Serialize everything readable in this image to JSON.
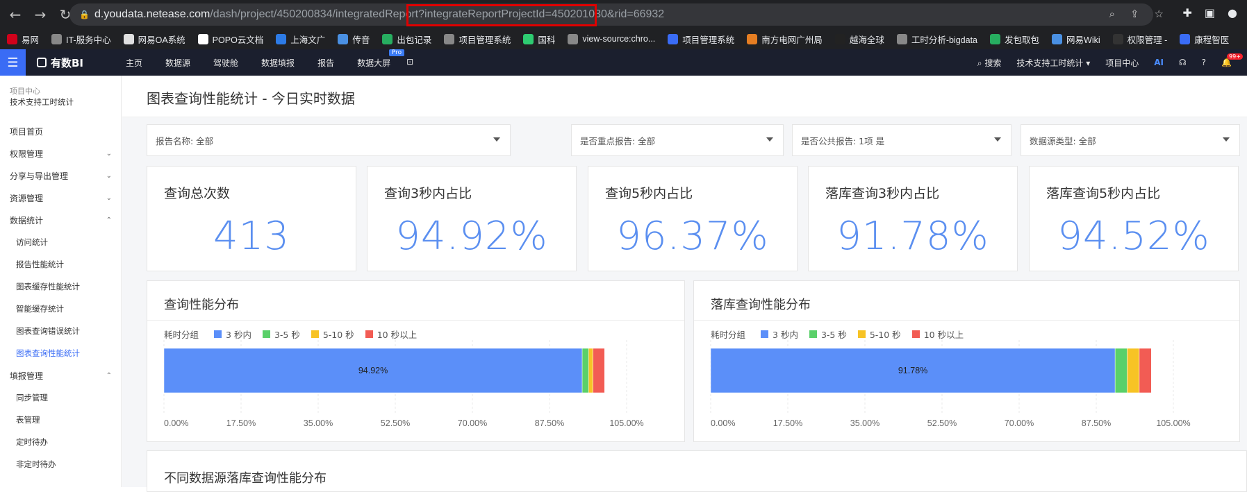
{
  "browser": {
    "url_host": "d.youdata.netease.com",
    "url_path": "/dash/project/450200834/integratedReport",
    "url_query_highlighted": "?integrateReportProjectId=450201030",
    "url_query_rest": "&rid=66932"
  },
  "bookmarks": [
    {
      "label": "易网",
      "color": "#d0021b"
    },
    {
      "label": "IT-服务中心",
      "color": "#888888"
    },
    {
      "label": "网易OA系统",
      "color": "#e0e0e0"
    },
    {
      "label": "POPO云文档",
      "color": "#ffffff"
    },
    {
      "label": "上海文广",
      "color": "#2d7be5"
    },
    {
      "label": "传音",
      "color": "#4a90e2"
    },
    {
      "label": "出包记录",
      "color": "#27ae60"
    },
    {
      "label": "项目管理系统",
      "color": "#888888"
    },
    {
      "label": "国科",
      "color": "#2ecc71"
    },
    {
      "label": "view-source:chro...",
      "color": "#888888"
    },
    {
      "label": "项目管理系统",
      "color": "#3a6cf5"
    },
    {
      "label": "南方电网广州局",
      "color": "#e67e22"
    },
    {
      "label": "越海全球",
      "color": "#222222"
    },
    {
      "label": "工时分析-bigdata",
      "color": "#888888"
    },
    {
      "label": "发包取包",
      "color": "#27ae60"
    },
    {
      "label": "网易Wiki",
      "color": "#4a90e2"
    },
    {
      "label": "权限管理 -",
      "color": "#333333"
    },
    {
      "label": "康程智医",
      "color": "#3a6cf5"
    }
  ],
  "appbar": {
    "logo": "有数BI",
    "nav": [
      "主页",
      "数据源",
      "驾驶舱",
      "数据填报",
      "报告",
      "数据大屏"
    ],
    "pro_badge": "Pro",
    "search": "搜索",
    "project_select": "技术支持工时统计",
    "project_center": "项目中心",
    "ai": "AI",
    "notif_badge": "99+"
  },
  "sidebar": {
    "project_label": "项目中心",
    "project_name": "技术支持工时统计",
    "items": [
      {
        "label": "项目首页",
        "sub": false,
        "chev": "",
        "active": false
      },
      {
        "label": "权限管理",
        "sub": false,
        "chev": "⌄",
        "active": false
      },
      {
        "label": "分享与导出管理",
        "sub": false,
        "chev": "⌄",
        "active": false
      },
      {
        "label": "资源管理",
        "sub": false,
        "chev": "⌄",
        "active": false
      },
      {
        "label": "数据统计",
        "sub": false,
        "chev": "⌃",
        "active": false
      },
      {
        "label": "访问统计",
        "sub": true,
        "chev": "",
        "active": false
      },
      {
        "label": "报告性能统计",
        "sub": true,
        "chev": "",
        "active": false
      },
      {
        "label": "图表缓存性能统计",
        "sub": true,
        "chev": "",
        "active": false
      },
      {
        "label": "智能缓存统计",
        "sub": true,
        "chev": "",
        "active": false
      },
      {
        "label": "图表查询错误统计",
        "sub": true,
        "chev": "",
        "active": false
      },
      {
        "label": "图表查询性能统计",
        "sub": true,
        "chev": "",
        "active": true
      },
      {
        "label": "填报管理",
        "sub": false,
        "chev": "⌃",
        "active": false
      },
      {
        "label": "同步管理",
        "sub": true,
        "chev": "",
        "active": false
      },
      {
        "label": "表管理",
        "sub": true,
        "chev": "",
        "active": false
      },
      {
        "label": "定时待办",
        "sub": true,
        "chev": "",
        "active": false
      },
      {
        "label": "非定时待办",
        "sub": true,
        "chev": "",
        "active": false
      }
    ]
  },
  "page": {
    "title": "图表查询性能统计 - 今日实时数据",
    "filters": [
      "报告名称: 全部",
      "是否重点报告: 全部",
      "是否公共报告: 1项 是",
      "数据源类型: 全部"
    ],
    "kpis": [
      {
        "label": "查询总次数",
        "value": "413"
      },
      {
        "label": "查询3秒内占比",
        "value": "94.92%"
      },
      {
        "label": "查询5秒内占比",
        "value": "96.37%"
      },
      {
        "label": "落库查询3秒内占比",
        "value": "91.78%"
      },
      {
        "label": "落库查询5秒内占比",
        "value": "94.52%"
      }
    ],
    "bottom_title": "不同数据源落库查询性能分布"
  },
  "legend": {
    "head": "耗时分组",
    "items": [
      {
        "label": "3 秒内",
        "color": "#5b8ff9"
      },
      {
        "label": "3-5 秒",
        "color": "#5ad06a"
      },
      {
        "label": "5-10 秒",
        "color": "#f7c325"
      },
      {
        "label": "10 秒以上",
        "color": "#f25c54"
      }
    ]
  },
  "chart_data": [
    {
      "type": "bar",
      "title": "查询性能分布",
      "orientation": "horizontal-stacked",
      "series": [
        {
          "name": "3 秒内",
          "values": [
            94.92
          ]
        },
        {
          "name": "3-5 秒",
          "values": [
            1.45
          ]
        },
        {
          "name": "5-10 秒",
          "values": [
            1.0
          ]
        },
        {
          "name": "10 秒以上",
          "values": [
            2.63
          ]
        }
      ],
      "data_label": "94.92%",
      "x_ticks": [
        "0.00%",
        "17.50%",
        "35.00%",
        "52.50%",
        "70.00%",
        "87.50%",
        "105.00%"
      ],
      "xlim": [
        0,
        105
      ]
    },
    {
      "type": "bar",
      "title": "落库查询性能分布",
      "orientation": "horizontal-stacked",
      "series": [
        {
          "name": "3 秒内",
          "values": [
            91.78
          ]
        },
        {
          "name": "3-5 秒",
          "values": [
            2.74
          ]
        },
        {
          "name": "5-10 秒",
          "values": [
            2.74
          ]
        },
        {
          "name": "10 秒以上",
          "values": [
            2.74
          ]
        }
      ],
      "data_label": "91.78%",
      "x_ticks": [
        "0.00%",
        "17.50%",
        "35.00%",
        "52.50%",
        "70.00%",
        "87.50%",
        "105.00%"
      ],
      "xlim": [
        0,
        105
      ]
    }
  ]
}
